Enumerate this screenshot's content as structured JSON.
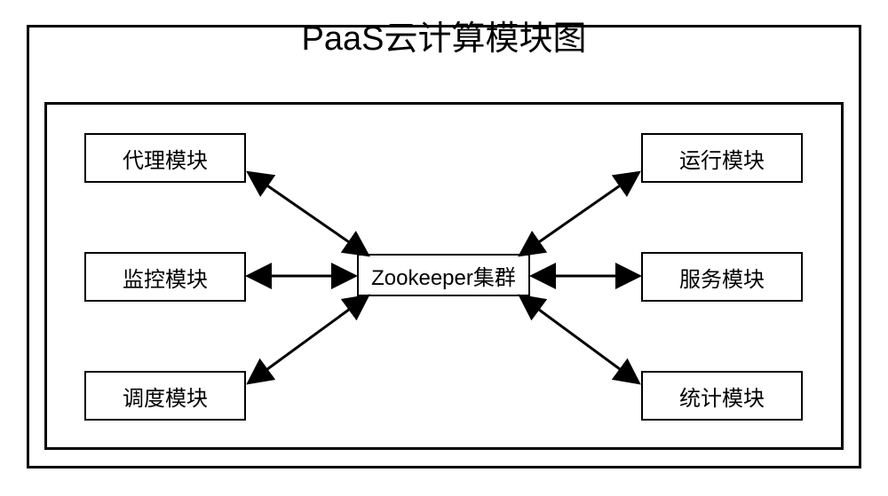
{
  "title": "PaaS云计算模块图",
  "center": {
    "label": "Zookeeper集群"
  },
  "modules": {
    "top_left": "代理模块",
    "mid_left": "监控模块",
    "bot_left": "调度模块",
    "top_right": "运行模块",
    "mid_right": "服务模块",
    "bot_right": "统计模块"
  },
  "chart_data": {
    "type": "diagram",
    "title": "PaaS云计算模块图",
    "center_node": "Zookeeper集群",
    "peripheral_nodes": [
      "代理模块",
      "监控模块",
      "调度模块",
      "运行模块",
      "服务模块",
      "统计模块"
    ],
    "edges": [
      {
        "from": "代理模块",
        "to": "Zookeeper集群",
        "bidirectional": true
      },
      {
        "from": "监控模块",
        "to": "Zookeeper集群",
        "bidirectional": true
      },
      {
        "from": "调度模块",
        "to": "Zookeeper集群",
        "bidirectional": true
      },
      {
        "from": "运行模块",
        "to": "Zookeeper集群",
        "bidirectional": true
      },
      {
        "from": "服务模块",
        "to": "Zookeeper集群",
        "bidirectional": true
      },
      {
        "from": "统计模块",
        "to": "Zookeeper集群",
        "bidirectional": true
      }
    ]
  }
}
